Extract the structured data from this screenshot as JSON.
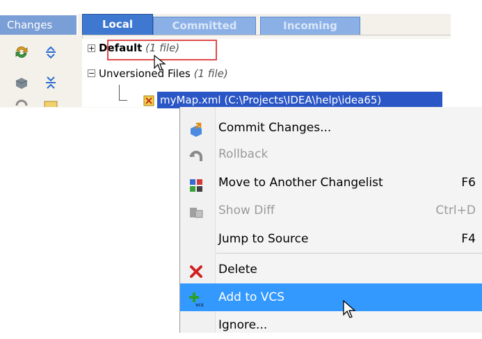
{
  "tool_window": {
    "title": "Changes",
    "tabs": [
      {
        "label": "Local",
        "active": true
      },
      {
        "label": "Committed",
        "active": false
      },
      {
        "label": "Incoming",
        "active": false
      }
    ]
  },
  "tree": {
    "default_label": "Default",
    "default_count": "(1 file)",
    "unversioned_label": "Unversioned Files",
    "unversioned_count": "(1 file)",
    "file_label": "myMap.xml (C:\\Projects\\IDEA\\help\\idea65)"
  },
  "context_menu": {
    "items": [
      {
        "label": "Commit Changes...",
        "shortcut": "",
        "icon": "commit-icon",
        "enabled": true
      },
      {
        "label": "Rollback",
        "shortcut": "",
        "icon": "rollback-icon",
        "enabled": false
      },
      {
        "label": "Move to Another Changelist",
        "shortcut": "F6",
        "icon": "move-changelist-icon",
        "enabled": true
      },
      {
        "label": "Show Diff",
        "shortcut": "Ctrl+D",
        "icon": "diff-icon",
        "enabled": false
      },
      {
        "label": "Jump to Source",
        "shortcut": "F4",
        "icon": "",
        "enabled": true
      },
      {
        "label": "Delete",
        "shortcut": "",
        "icon": "delete-icon",
        "enabled": true
      },
      {
        "label": "Add to VCS",
        "shortcut": "",
        "icon": "add-vcs-icon",
        "enabled": true,
        "highlighted": true
      },
      {
        "label": "Ignore...",
        "shortcut": "",
        "icon": "",
        "enabled": true
      }
    ]
  },
  "colors": {
    "selection": "#2a56c6",
    "menu_highlight": "#3399ff",
    "active_tab": "#3f78d0",
    "callout": "#e04848"
  }
}
